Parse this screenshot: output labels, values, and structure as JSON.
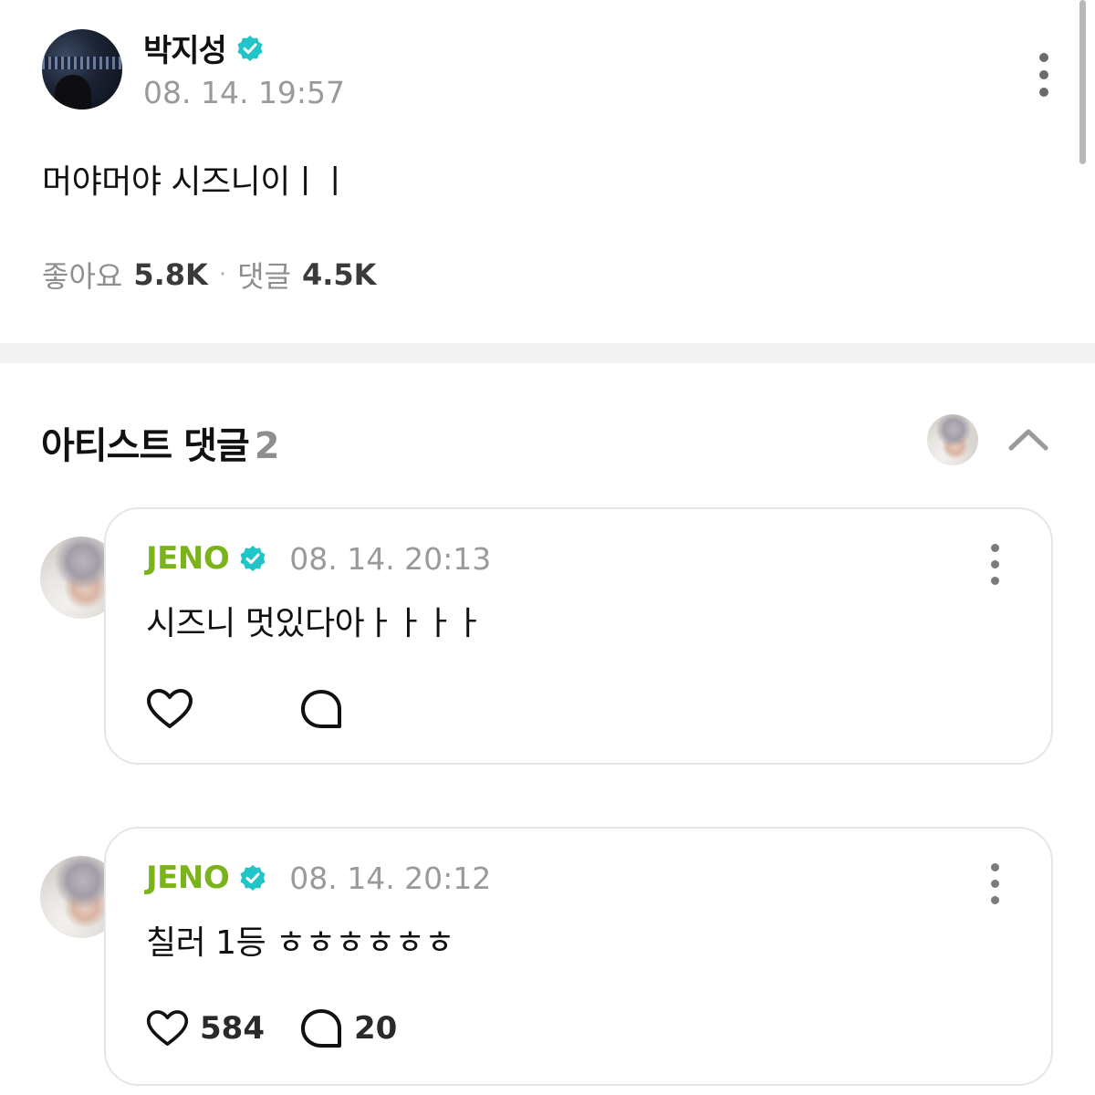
{
  "post": {
    "author": "박지성",
    "timestamp": "08. 14. 19:57",
    "text": "머야머야 시즈니이ㅣㅣ",
    "stats": {
      "likes_label": "좋아요",
      "likes_value": "5.8K",
      "separator": "·",
      "comments_label": "댓글",
      "comments_value": "4.5K"
    }
  },
  "artist_comments": {
    "title": "아티스트 댓글",
    "count": "2",
    "comments": [
      {
        "author": "JENO",
        "timestamp": "08. 14. 20:13",
        "text": "시즈니 멋있다아ㅏㅏㅏㅏ",
        "likes": "",
        "replies": ""
      },
      {
        "author": "JENO",
        "timestamp": "08. 14. 20:12",
        "text": "칠러 1등 ㅎㅎㅎㅎㅎㅎ",
        "likes": "584",
        "replies": "20"
      }
    ]
  },
  "colors": {
    "verified_badge": "#22c5c7",
    "artist_name": "#7bb31a",
    "muted_text": "#9a9a9a",
    "card_border": "#e6e6e6",
    "divider": "#f2f2f2"
  },
  "icons": [
    "verified-icon",
    "more-vertical-icon",
    "chevron-up-icon",
    "heart-icon",
    "comment-bubble-icon"
  ]
}
